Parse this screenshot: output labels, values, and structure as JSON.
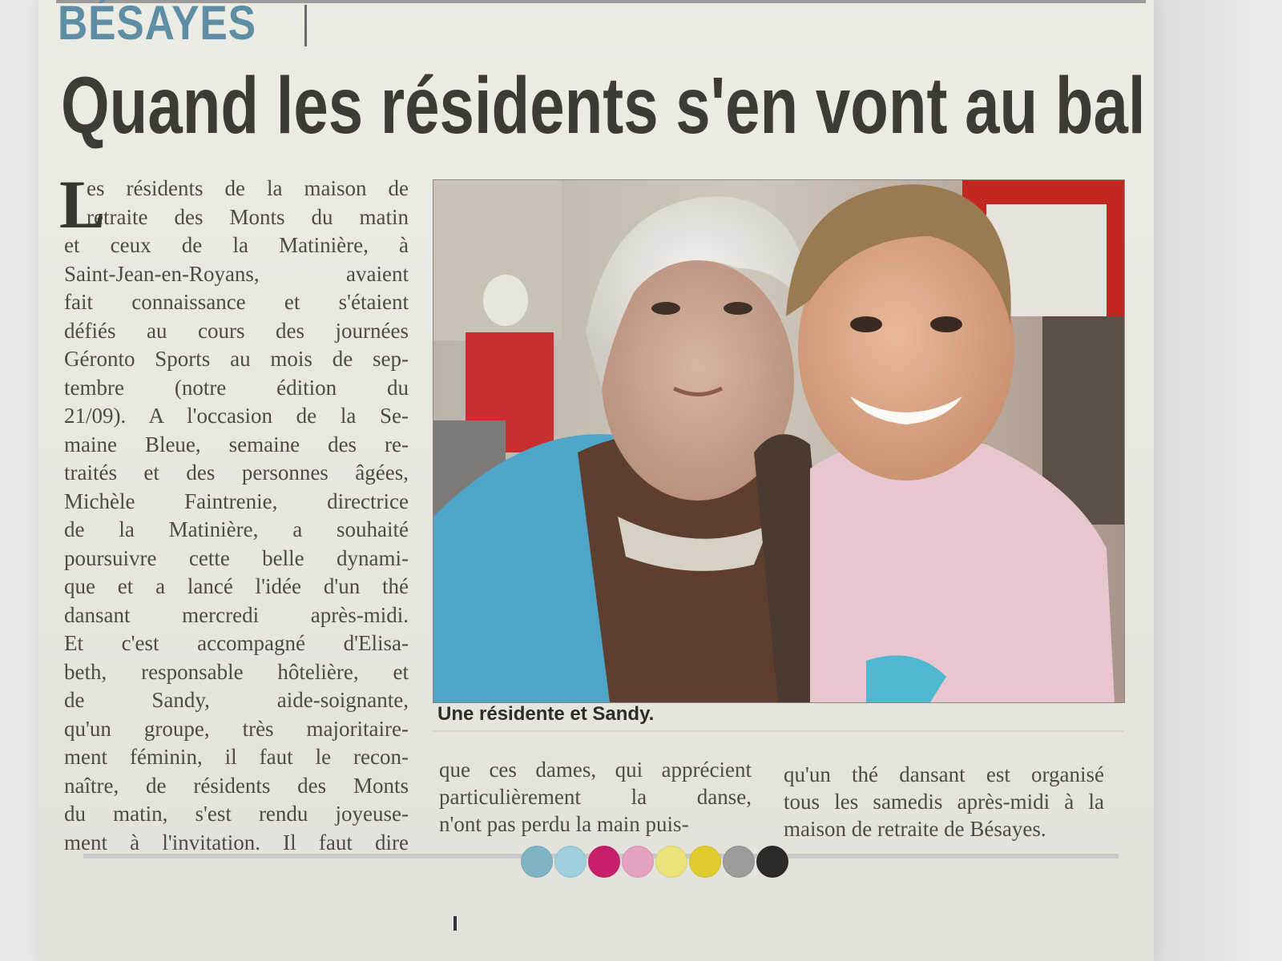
{
  "section_label": "BÉSAYES",
  "headline": "Quand les résidents s'en vont au bal",
  "dropcap": "L",
  "column1": [
    "es résidents de la maison de",
    "retraite des Monts du matin",
    "et ceux de la Matinière, à",
    "Saint-Jean-en-Royans, avaient",
    "fait connaissance et s'étaient",
    "défiés au cours des journées",
    "Géronto Sports au mois de sep-",
    "tembre (notre édition du",
    "21/09). A l'occasion de la Se-",
    "maine Bleue, semaine des re-",
    "traités et des personnes âgées,",
    "Michèle Faintrenie, directrice",
    "de la Matinière, a souhaité",
    "poursuivre cette belle dynami-",
    "que et a lancé l'idée d'un thé",
    "dansant mercredi après-midi.",
    "Et c'est accompagné d'Elisa-",
    "beth, responsable hôtelière, et",
    "de Sandy, aide-soignante,",
    "qu'un groupe, très majoritaire-",
    "ment féminin, il faut le recon-",
    "naître, de résidents des Monts",
    "du matin, s'est rendu joyeuse-",
    "ment à l'invitation. Il faut dire"
  ],
  "column2": [
    "que ces dames, qui apprécient",
    "particulièrement la danse,",
    "n'ont pas perdu la main puis-"
  ],
  "column3": [
    "qu'un thé dansant est organisé",
    "tous les samedis après-midi à la",
    "maison de retraite de Bésayes."
  ],
  "caption": "Une résidente et Sandy.",
  "color_bar": [
    "#7fb4c4",
    "#9fcfdc",
    "#c8206a",
    "#e3a2bf",
    "#ebe37a",
    "#e0cc2e",
    "#9c9b98",
    "#2e2a28"
  ],
  "colors": {
    "section": "#5e8ea3",
    "headline": "#3f3a35",
    "body_text": "#4e4a45",
    "paper": "#ecebe4"
  }
}
